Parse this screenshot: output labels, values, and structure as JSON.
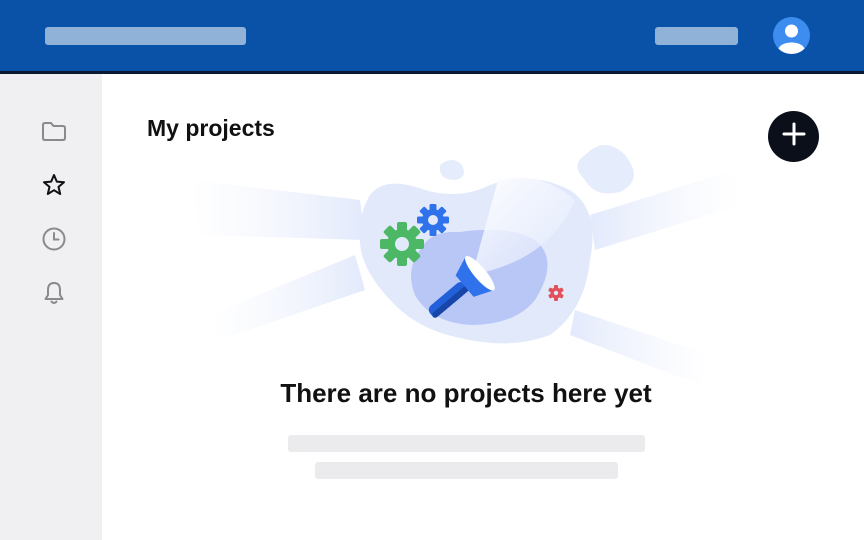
{
  "header": {
    "avatar_icon": "user-avatar-icon",
    "background": "#0a52a8"
  },
  "sidebar": {
    "items": [
      {
        "icon": "folder-icon"
      },
      {
        "icon": "star-icon"
      },
      {
        "icon": "clock-icon"
      },
      {
        "icon": "bell-icon"
      }
    ]
  },
  "main": {
    "title": "My projects",
    "add_button_icon": "plus-icon",
    "empty_state": {
      "heading": "There are no projects here yet",
      "illustration": "flashlight-gears-illustration"
    }
  }
}
